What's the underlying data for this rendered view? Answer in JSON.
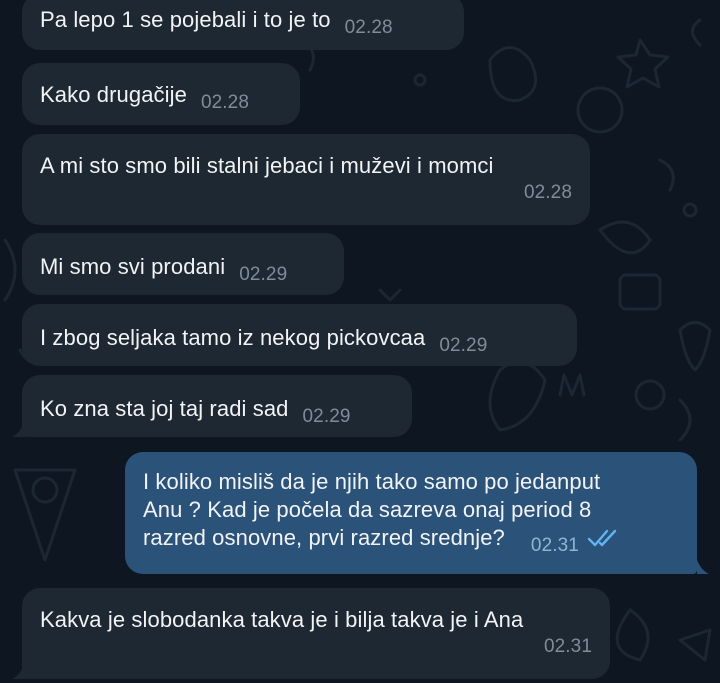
{
  "colors": {
    "background": "#0e1621",
    "incoming_bubble": "#1e2832",
    "outgoing_bubble": "#2b5278",
    "text": "#f1f3f5",
    "time_incoming": "#7f8c99",
    "time_outgoing": "#8fb4d6",
    "read_check": "#63b2f2"
  },
  "messages": [
    {
      "text": "Pa lepo 1 se pojebali i to je to",
      "time": "02.28"
    },
    {
      "text": "Kako drugačije",
      "time": "02.28"
    },
    {
      "text": "A mi sto smo bili stalni jebaci i muževi i momci",
      "time": "02.28"
    },
    {
      "text": "Mi smo svi prodani",
      "time": "02.29"
    },
    {
      "text": "I zbog seljaka tamo iz nekog pickovcaa",
      "time": "02.29"
    },
    {
      "text": "Ko zna sta joj taj radi sad",
      "time": "02.29"
    },
    {
      "text": "I koliko misliš da je njih tako samo po jedanput\nAnu ? Kad je počela da sazreva onaj period 8\nrazred osnovne, prvi razred srednje?",
      "time": "02.31",
      "status_icon": "double-check-icon"
    },
    {
      "text": "Kakva je slobodanka takva je i bilja takva je i Ana",
      "time": "02.31"
    }
  ]
}
